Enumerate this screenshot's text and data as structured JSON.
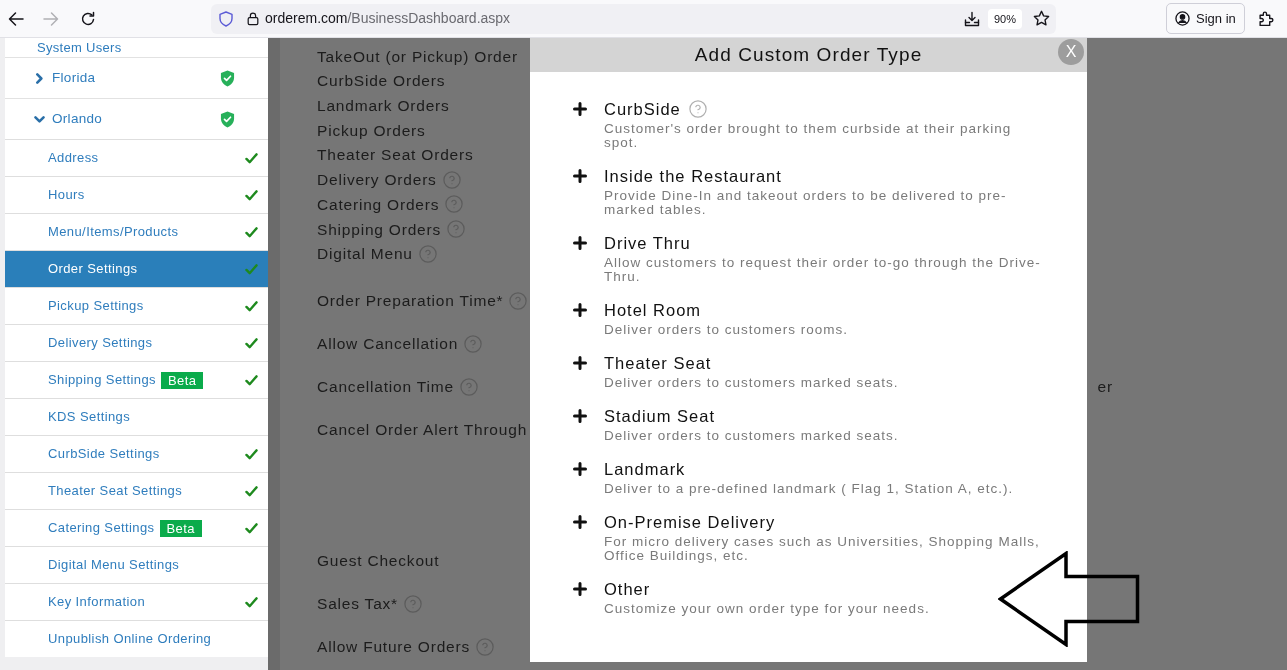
{
  "browser": {
    "url_host": "orderem.com",
    "url_path": "/BusinessDashboard.aspx",
    "zoom_level": "90%",
    "sign_in": "Sign in"
  },
  "sidebar": {
    "top_item": "System Users",
    "locations": [
      {
        "label": "Florida",
        "expanded": false,
        "verified": true
      },
      {
        "label": "Orlando",
        "expanded": true,
        "verified": true,
        "children": [
          {
            "label": "Address",
            "selected": false,
            "complete": true
          },
          {
            "label": "Hours",
            "selected": false,
            "complete": true
          },
          {
            "label": "Menu/Items/Products",
            "selected": false,
            "complete": true
          },
          {
            "label": "Order Settings",
            "selected": true,
            "complete": true
          },
          {
            "label": "Pickup Settings",
            "selected": false,
            "complete": true
          },
          {
            "label": "Delivery Settings",
            "selected": false,
            "complete": true
          },
          {
            "label": "Shipping Settings",
            "badge": "Beta",
            "selected": false,
            "complete": true
          },
          {
            "label": "KDS Settings",
            "selected": false,
            "complete": false
          },
          {
            "label": "CurbSide Settings",
            "selected": false,
            "complete": true
          },
          {
            "label": "Theater Seat Settings",
            "selected": false,
            "complete": true
          },
          {
            "label": "Catering Settings",
            "badge": "Beta",
            "selected": false,
            "complete": true
          },
          {
            "label": "Digital Menu Settings",
            "selected": false,
            "complete": false
          },
          {
            "label": "Key Information",
            "selected": false,
            "complete": true
          },
          {
            "label": "Unpublish Online Ordering",
            "selected": false,
            "complete": false
          }
        ]
      }
    ]
  },
  "main": {
    "sections": [
      {
        "kind": "list",
        "rows": [
          {
            "label": "TakeOut (or Pickup) Order",
            "help": false
          },
          {
            "label": "CurbSide Orders",
            "help": false
          },
          {
            "label": "Landmark Orders",
            "help": false
          },
          {
            "label": "Pickup Orders",
            "help": false
          },
          {
            "label": "Theater Seat Orders",
            "help": false
          },
          {
            "label": "Delivery Orders",
            "help": true
          },
          {
            "label": "Catering Orders",
            "help": true
          },
          {
            "label": "Shipping Orders",
            "help": true
          },
          {
            "label": "Digital Menu",
            "help": true
          }
        ]
      },
      {
        "kind": "form",
        "rows": [
          {
            "label": "Order Preparation Time*",
            "help": true
          },
          {
            "label": "Allow Cancellation",
            "help": true
          },
          {
            "label": "Cancellation Time",
            "help": true,
            "column_2": "er"
          },
          {
            "label": "Cancel Order Alert Through",
            "help": false
          }
        ]
      },
      {
        "kind": "form",
        "rows": [
          {
            "label": "Guest Checkout",
            "help": false
          },
          {
            "label": "Sales Tax*",
            "help": true
          },
          {
            "label": "Allow Future Orders",
            "help": true
          }
        ]
      }
    ]
  },
  "modal": {
    "title": "Add Custom Order Type",
    "close_label": "X",
    "options": [
      {
        "title": "CurbSide",
        "help": true,
        "description": "Customer's order brought to them curbside at their parking spot."
      },
      {
        "title": "Inside the Restaurant",
        "help": false,
        "description": "Provide Dine-In and takeout orders to be delivered to pre-marked tables."
      },
      {
        "title": "Drive Thru",
        "help": false,
        "description": "Allow customers to request their order to-go through the Drive-Thru."
      },
      {
        "title": "Hotel Room",
        "help": false,
        "description": "Deliver orders to customers rooms."
      },
      {
        "title": "Theater Seat",
        "help": false,
        "description": "Deliver orders to customers marked seats."
      },
      {
        "title": "Stadium Seat",
        "help": false,
        "description": "Deliver orders to customers marked seats."
      },
      {
        "title": "Landmark",
        "help": false,
        "description": "Deliver to a pre-defined landmark ( Flag 1, Station A, etc.)."
      },
      {
        "title": "On-Premise Delivery",
        "help": false,
        "description": "For micro delivery cases such as Universities, Shopping Malls, Office Buildings, etc."
      },
      {
        "title": "Other",
        "help": false,
        "description": "Customize your own order type for your needs."
      }
    ]
  }
}
